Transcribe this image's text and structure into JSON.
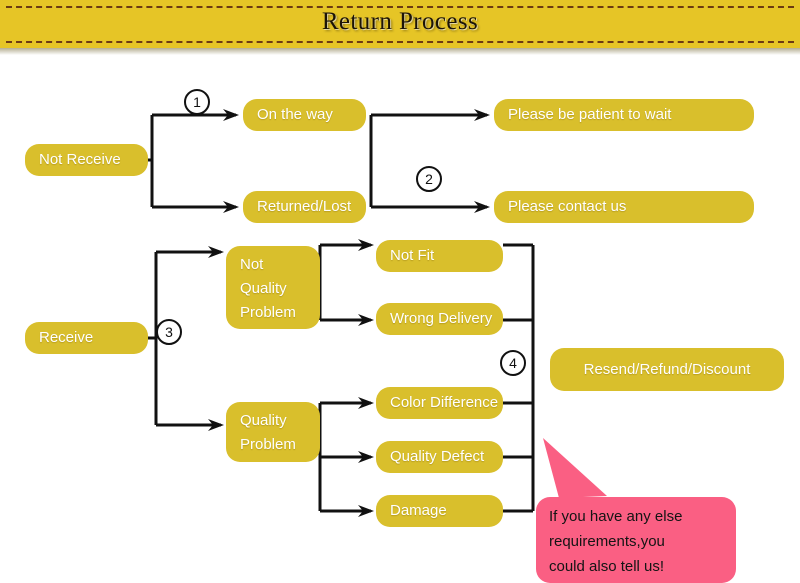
{
  "header": {
    "title": "Return Process",
    "background_color": "#e6c526",
    "dash_color": "#6b3a12"
  },
  "theme": {
    "node_color": "#d9bf2c",
    "node_text_color": "#ffffff",
    "edge_color": "#111111",
    "callout_color": "#fa5f83",
    "callout_text_color": "#141414",
    "page_background": "#ffffff"
  },
  "diagram": {
    "type": "flowchart",
    "steps": [
      {
        "id": "step-1",
        "label": "1"
      },
      {
        "id": "step-2",
        "label": "2"
      },
      {
        "id": "step-3",
        "label": "3"
      },
      {
        "id": "step-4",
        "label": "4"
      }
    ],
    "nodes": {
      "not_receive": "Not Receive",
      "on_the_way": "On the way",
      "returned_lost": "Returned/Lost",
      "please_wait": "Please be patient to wait",
      "please_contact": "Please contact us",
      "receive": "Receive",
      "not_quality_problem": "Not\nQuality\nProblem",
      "quality_problem": "Quality\nProblem",
      "not_fit": "Not Fit",
      "wrong_delivery": "Wrong Delivery",
      "color_difference": "Color Difference",
      "quality_defect": "Quality Defect",
      "damage": "Damage",
      "resolution": "Resend/Refund/Discount"
    },
    "callout": {
      "text": "If you have any else\nrequirements,you\ncould also tell us!"
    }
  }
}
